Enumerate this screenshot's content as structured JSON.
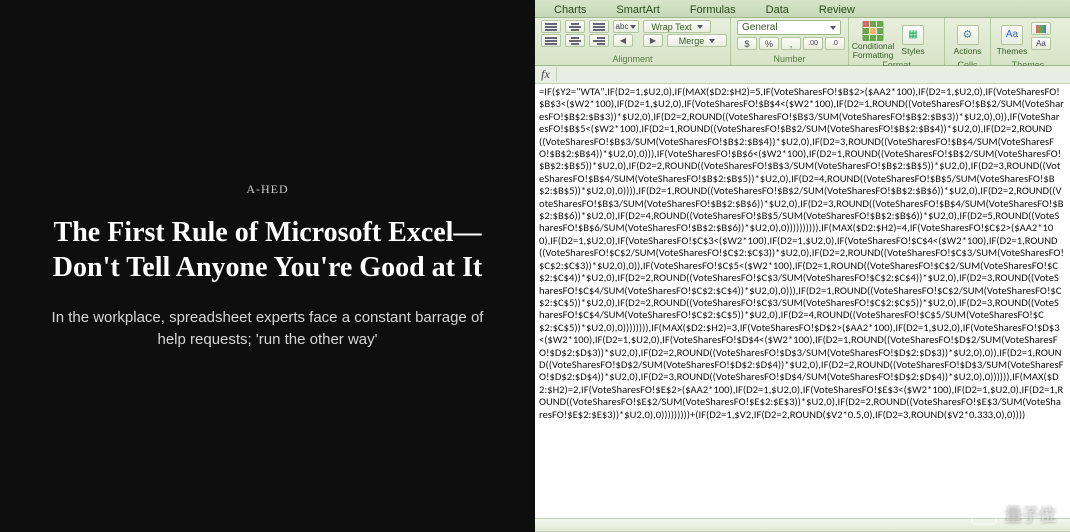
{
  "article": {
    "kicker": "A-HED",
    "headline": "The First Rule of Microsoft Excel—Don't Tell Anyone You're Good at It",
    "dek": "In the workplace, spreadsheet experts face a constant barrage of help requests; 'run the other way'"
  },
  "ribbon": {
    "tabs": [
      "Charts",
      "SmartArt",
      "Formulas",
      "Data",
      "Review"
    ],
    "groups": {
      "alignment": {
        "label": "Alignment",
        "wrap": "Wrap Text",
        "merge": "Merge",
        "abc": "abc"
      },
      "number": {
        "label": "Number",
        "format": "General",
        "currency": "$",
        "percent": "%",
        "comma": ",",
        "inc": ".00→.0",
        "dec": ".0→.00"
      },
      "format": {
        "label": "Format",
        "conditional": "Conditional Formatting",
        "styles": "Styles"
      },
      "cells": {
        "label": "Cells",
        "actions": "Actions"
      },
      "themes": {
        "label": "Themes",
        "themes": "Themes",
        "aa": "Aa"
      }
    }
  },
  "fx": {
    "label": "fx"
  },
  "formula": "=IF($Y2=\"WTA\",IF(D2=1,$U2,0),IF(MAX($D2:$H2)=5,IF(VoteSharesFO!$B$2>($AA2*100),IF(D2=1,$U2,0),IF(VoteSharesFO!$B$3<($W2*100),IF(D2=1,$U2,0),IF(VoteSharesFO!$B$4<($W2*100),IF(D2=1,ROUND((VoteSharesFO!$B$2/SUM(VoteSharesFO!$B$2:$B$3))*$U2,0),IF(D2=2,ROUND((VoteSharesFO!$B$3/SUM(VoteSharesFO!$B$2:$B$3))*$U2,0),0)),IF(VoteSharesFO!$B$5<($W2*100),IF(D2=1,ROUND((VoteSharesFO!$B$2/SUM(VoteSharesFO!$B$2:$B$4))*$U2,0),IF(D2=2,ROUND((VoteSharesFO!$B$3/SUM(VoteSharesFO!$B$2:$B$4))*$U2,0),IF(D2=3,ROUND((VoteSharesFO!$B$4/SUM(VoteSharesFO!$B$2:$B$4))*$U2,0),0))),IF(VoteSharesFO!$B$6<($W2*100),IF(D2=1,ROUND((VoteSharesFO!$B$2/SUM(VoteSharesFO!$B$2:$B$5))*$U2,0),IF(D2=2,ROUND((VoteSharesFO!$B$3/SUM(VoteSharesFO!$B$2:$B$5))*$U2,0),IF(D2=3,ROUND((VoteSharesFO!$B$4/SUM(VoteSharesFO!$B$2:$B$5))*$U2,0),IF(D2=4,ROUND((VoteSharesFO!$B$5/SUM(VoteSharesFO!$B$2:$B$5))*$U2,0),0)))),IF(D2=1,ROUND((VoteSharesFO!$B$2/SUM(VoteSharesFO!$B$2:$B$6))*$U2,0),IF(D2=2,ROUND((VoteSharesFO!$B$3/SUM(VoteSharesFO!$B$2:$B$6))*$U2,0),IF(D2=3,ROUND((VoteSharesFO!$B$4/SUM(VoteSharesFO!$B$2:$B$6))*$U2,0),IF(D2=4,ROUND((VoteSharesFO!$B$5/SUM(VoteSharesFO!$B$2:$B$6))*$U2,0),IF(D2=5,ROUND((VoteSharesFO!$B$6/SUM(VoteSharesFO!$B$2:$B$6))*$U2,0),0)))))))))),IF(MAX($D2:$H2)=4,IF(VoteSharesFO!$C$2>($AA2*100),IF(D2=1,$U2,0),IF(VoteSharesFO!$C$3<($W2*100),IF(D2=1,$U2,0),IF(VoteSharesFO!$C$4<($W2*100),IF(D2=1,ROUND((VoteSharesFO!$C$2/SUM(VoteSharesFO!$C$2:$C$3))*$U2,0),IF(D2=2,ROUND((VoteSharesFO!$C$3/SUM(VoteSharesFO!$C$2:$C$3))*$U2,0),0)),IF(VoteSharesFO!$C$5<($W2*100),IF(D2=1,ROUND((VoteSharesFO!$C$2/SUM(VoteSharesFO!$C$2:$C$4))*$U2,0),IF(D2=2,ROUND((VoteSharesFO!$C$3/SUM(VoteSharesFO!$C$2:$C$4))*$U2,0),IF(D2=3,ROUND((VoteSharesFO!$C$4/SUM(VoteSharesFO!$C$2:$C$4))*$U2,0),0))),IF(D2=1,ROUND((VoteSharesFO!$C$2/SUM(VoteSharesFO!$C$2:$C$5))*$U2,0),IF(D2=2,ROUND((VoteSharesFO!$C$3/SUM(VoteSharesFO!$C$2:$C$5))*$U2,0),IF(D2=3,ROUND((VoteSharesFO!$C$4/SUM(VoteSharesFO!$C$2:$C$5))*$U2,0),IF(D2=4,ROUND((VoteSharesFO!$C$5/SUM(VoteSharesFO!$C$2:$C$5))*$U2,0),0)))))))),IF(MAX($D2:$H2)=3,IF(VoteSharesFO!$D$2>($AA2*100),IF(D2=1,$U2,0),IF(VoteSharesFO!$D$3<($W2*100),IF(D2=1,$U2,0),IF(VoteSharesFO!$D$4<($W2*100),IF(D2=1,ROUND((VoteSharesFO!$D$2/SUM(VoteSharesFO!$D$2:$D$3))*$U2,0),IF(D2=2,ROUND((VoteSharesFO!$D$3/SUM(VoteSharesFO!$D$2:$D$3))*$U2,0),0)),IF(D2=1,ROUND((VoteSharesFO!$D$2/SUM(VoteSharesFO!$D$2:$D$4))*$U2,0),IF(D2=2,ROUND((VoteSharesFO!$D$3/SUM(VoteSharesFO!$D$2:$D$4))*$U2,0),IF(D2=3,ROUND((VoteSharesFO!$D$4/SUM(VoteSharesFO!$D$2:$D$4))*$U2,0),0)))))),IF(MAX($D2:$H2)=2,IF(VoteSharesFO!$E$2>($AA2*100),IF(D2=1,$U2,0),IF(VoteSharesFO!$E$3<($W2*100),IF(D2=1,$U2,0),IF(D2=1,ROUND((VoteSharesFO!$E$2/SUM(VoteSharesFO!$E$2:$E$3))*$U2,0),IF(D2=2,ROUND((VoteSharesFO!$E$3/SUM(VoteSharesFO!$E$2:$E$3))*$U2,0),0)))))))))+(IF(D2=1,$V2,IF(D2=2,ROUND($V2*0.5,0),IF(D2=3,ROUND($V2*0.333,0),0))))",
  "watermark": {
    "text": "量子位"
  }
}
